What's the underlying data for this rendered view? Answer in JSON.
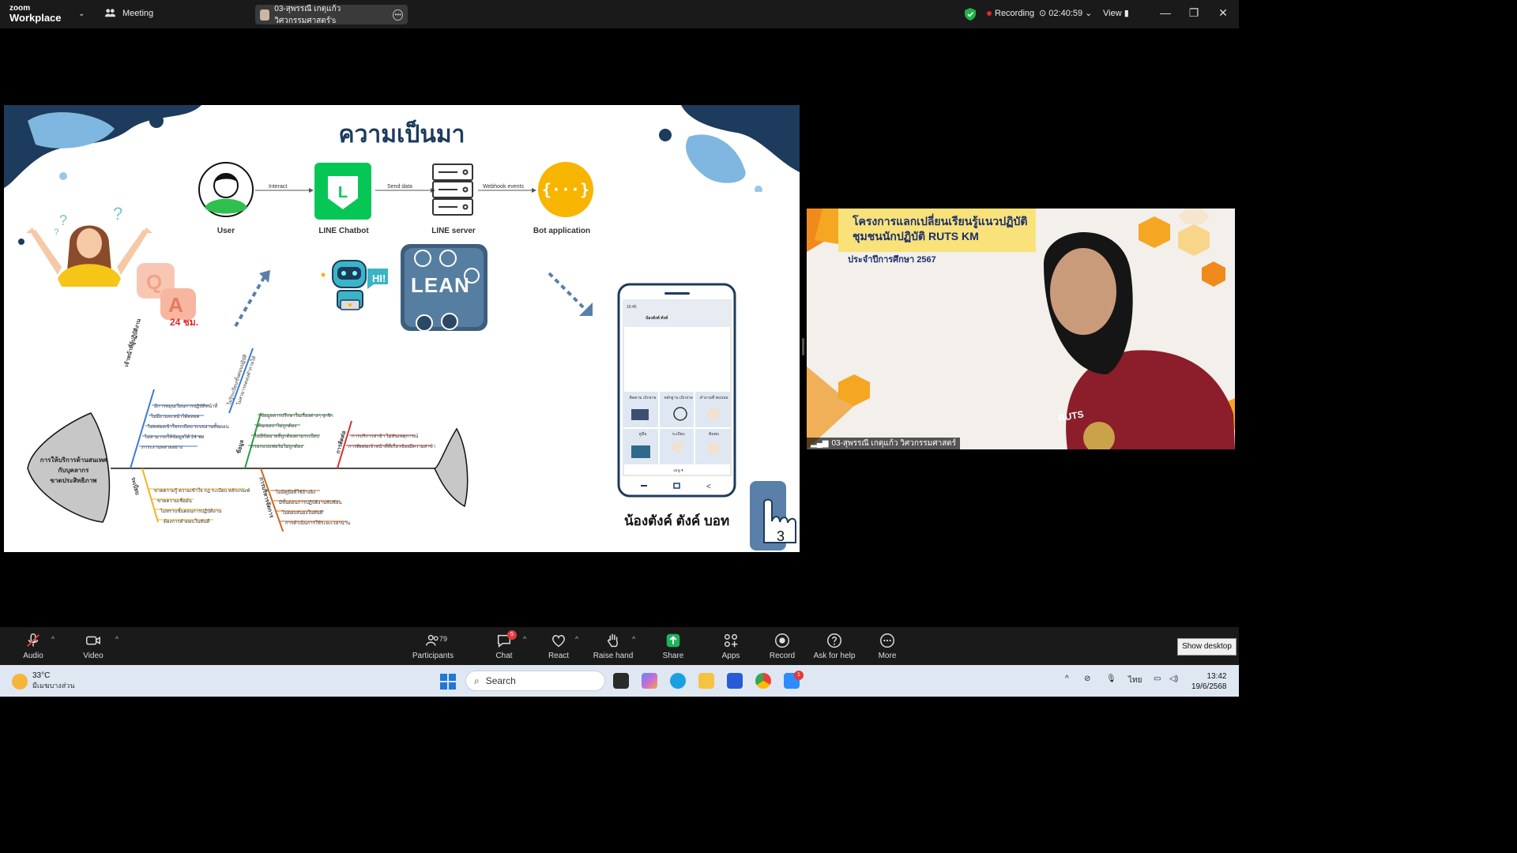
{
  "titlebar": {
    "logo_top": "zoom",
    "logo_bottom": "Workplace",
    "meeting_label": "Meeting",
    "speaker_chip": "03-สุพรรณี เกตุแก้ว วิศวกรรมศาสตร์'s",
    "recording_label": "Recording",
    "timer": "02:40:59",
    "view_label": "View"
  },
  "slide": {
    "title": "ความเป็นมา",
    "flow": {
      "nodes": [
        "User",
        "LINE Chatbot",
        "LINE server",
        "Bot application"
      ],
      "edges": [
        "Interact",
        "Send data",
        "Webhook events"
      ]
    },
    "qa": {
      "q": "Q",
      "a": "A",
      "hours": "24 ชม."
    },
    "lean_text": "LEAN",
    "hi_text": "HI!",
    "fishbone": {
      "head": [
        "การให้บริการด้านสนเทศ",
        "กับบุคลากร",
        "ขาดประสิทธิภาพ"
      ],
      "cat_top_1": "เจ้าหน้าที่ผู้ปฏิบัติงาน",
      "cat_top_2": "ข้อมูล",
      "cat_top_3": "การติดต่อ",
      "cat_bot_1": "ระเบียบ",
      "cat_bot_2": "การบริหารจัดการ",
      "diag_1": "ไม่รู้ระเบียบ/ขั้นตอนปฏิบัติ",
      "diag_2": "ไม่สามารถตอบคำถามได้",
      "t1": [
        "มีการหมุนเวียนการปฏิบัติหน้าที่",
        "ไม่มีงานจะหน้าได้ตลอด",
        "ไม่คล่องเข้าใจระเบียบ ระบบงานขั้นตอน",
        "ไม่สามารถให้ข้อมูลได้ 24 ชม",
        "ภาระงานหลายอย่าง"
      ],
      "t2": [
        "ข้อมูลสารปรึกษาในเรื่องต่างๆ จุกจิก",
        "ค้นเจอบ่าไม่ถูกต้อง",
        "ไม่มีข้อมายที่ถูกต้องตามระเบียบ",
        "กรอกแบบฟอร์มไม่ถูกต้อง"
      ],
      "t3": [
        "การบริการล่าช้า ไม่ทันเหตุการณ์",
        "การติดต่อเจ้าหน้าที่ที่เกี่ยวข้องมีความล่าช้า"
      ],
      "b1": [
        "ขาดความรู้ ความเข้าใจ กฎ ระเบียบ หลักเกณฑ์",
        "ขาดความเชื่อมั่น",
        "ไม่ทราบขั้นตอนการปฏิบัติงาน",
        "ต้องการคำตอบในทันที"
      ],
      "b2": [
        "ไม่มีคู่มือที่ใช้อ้างอิง",
        "มีขั้นตอนการปฏิบัติงานซับซ้อน",
        "ไม่ตอบสนองในทันที",
        "การดำเนินการใช้ระยะเวลานาน"
      ]
    },
    "phone": {
      "time": "16:45",
      "chat_name": "น้องตังค์ ตังค์",
      "menu": [
        "ติดตาม เบิกจ่าย",
        "หลักฐาน เบิกจ่าย",
        "คำถามที่ พบบ่อย",
        "คู่มือ",
        "ระเบียบ",
        "ติดต่อ"
      ],
      "footer": "เมนู ▾",
      "caption": "น้องตังค์ ตังค์ บอท"
    },
    "page_number": "3"
  },
  "video": {
    "banner_line1": "โครงการแลกเปลี่ยนเรียนรู้แนวปฏิบัติ",
    "banner_line2": "ชุมชนนักปฏิบัติ RUTS KM",
    "banner_line3": "ประจำปีการศึกษา 2567",
    "shirt_logo": "RUTS",
    "name_tag": "03-สุพรรณี เกตุแก้ว วิศวกรรมศาสตร์"
  },
  "toolbar": {
    "audio": "Audio",
    "video": "Video",
    "participants": "Participants",
    "participants_count": "79",
    "chat": "Chat",
    "chat_badge": "5",
    "react": "React",
    "raise_hand": "Raise hand",
    "share": "Share",
    "apps": "Apps",
    "record": "Record",
    "ask_help": "Ask for help",
    "more": "More",
    "show_desktop": "Show desktop"
  },
  "taskbar": {
    "temperature": "33°C",
    "condition": "มีเมฆบางส่วน",
    "search_placeholder": "Search",
    "language": "ไทย",
    "time": "13:42",
    "date": "19/6/2568",
    "notification_badge": "1"
  },
  "colors": {
    "zoom_blue": "#0e72ed",
    "slide_navy": "#1d3b5c",
    "line_green": "#06c755",
    "bot_yellow": "#f7b500",
    "record_red": "#e02828",
    "share_green": "#1fb35b"
  }
}
